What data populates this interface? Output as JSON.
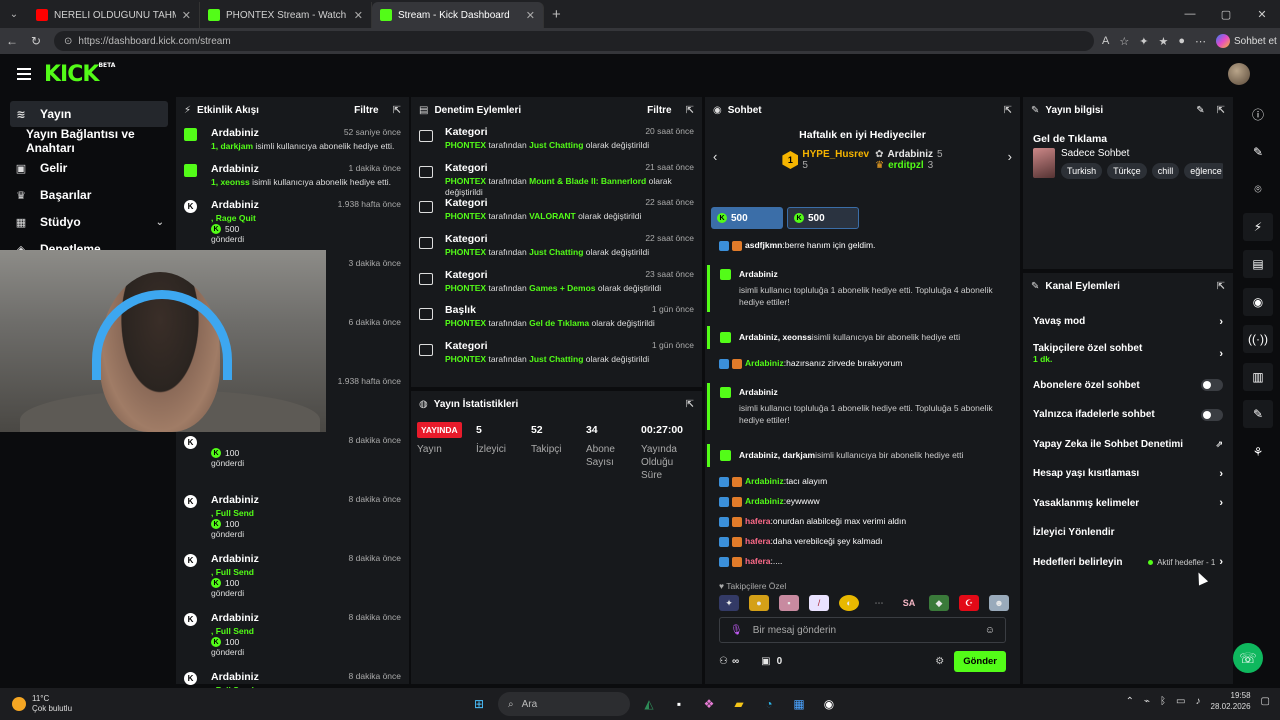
{
  "browser": {
    "tabs": [
      {
        "title": "NERELİ OLDUĞUNU TAHMİN ETİ",
        "favicon_color": "#ff0000"
      },
      {
        "title": "PHONTEX Stream - Watch Live on",
        "favicon_color": "#53fc18"
      },
      {
        "title": "Stream - Kick Dashboard",
        "favicon_color": "#53fc18",
        "active": true
      }
    ],
    "url": "https://dashboard.kick.com/stream",
    "copilot_label": "Sohbet et",
    "accent": "#53fc18"
  },
  "header": {
    "logo": "KICK",
    "logo_badge": "BETA"
  },
  "leftnav": {
    "items": [
      {
        "label": "Yayın",
        "icon": "broadcast-icon",
        "active": true
      },
      {
        "label": "Yayın Bağlantısı ve Anahtarı",
        "icon": "",
        "sub": true
      },
      {
        "label": "Gelir",
        "icon": "money-icon"
      },
      {
        "label": "Başarılar",
        "icon": "trophy-icon"
      },
      {
        "label": "Stüdyo",
        "icon": "studio-icon",
        "chevron": true
      },
      {
        "label": "Denetleme",
        "icon": "shield-icon"
      }
    ]
  },
  "activity": {
    "title": "Etkinlik Akışı",
    "filter": "Filtre",
    "items": [
      {
        "type": "gift",
        "name": "Ardabiniz",
        "time": "52 saniye önce",
        "hl": "1, darkjam",
        "desc": " isimli kullanıcıya abonelik hediye etti."
      },
      {
        "type": "gift",
        "name": "Ardabiniz",
        "time": "1 dakika önce",
        "hl": "1, xeonss",
        "desc": " isimli kullanıcıya abonelik hediye etti."
      },
      {
        "type": "kick",
        "name": "Ardabiniz",
        "time": "1.938 hafta önce",
        "hl": ", Rage Quit",
        "amount": "500",
        "sent": "gönderdi"
      },
      {
        "type": "hidden",
        "name": "",
        "time": "3 dakika önce",
        "hl": "",
        "desc": "abonelik hediye"
      },
      {
        "type": "hidden",
        "name": "",
        "time": "6 dakika önce",
        "hl": "",
        "desc": "elik hediye etti."
      },
      {
        "type": "hidden",
        "name": "",
        "time": "1.938 hafta önce",
        "hl": "",
        "desc": ""
      },
      {
        "type": "kick",
        "name": "",
        "time": "8 dakika önce",
        "hl": "",
        "amount": "100",
        "sent": "gönderdi"
      },
      {
        "type": "kick",
        "name": "Ardabiniz",
        "time": "8 dakika önce",
        "hl": ", Full Send",
        "amount": "100",
        "sent": "gönderdi"
      },
      {
        "type": "kick",
        "name": "Ardabiniz",
        "time": "8 dakika önce",
        "hl": ", Full Send",
        "amount": "100",
        "sent": "gönderdi"
      },
      {
        "type": "kick",
        "name": "Ardabiniz",
        "time": "8 dakika önce",
        "hl": ", Full Send",
        "amount": "100",
        "sent": "gönderdi"
      },
      {
        "type": "kick",
        "name": "Ardabiniz",
        "time": "8 dakika önce",
        "hl": ", Full Send",
        "amount": "100",
        "sent": ""
      }
    ]
  },
  "moderation": {
    "title": "Denetim Eylemleri",
    "filter": "Filtre",
    "items": [
      {
        "t": "Kategori",
        "time": "20 saat önce",
        "u": "PHONTEX",
        "mid": " tarafından ",
        "g": "Just Chatting",
        "end": " olarak değiştirildi"
      },
      {
        "t": "Kategori",
        "time": "21 saat önce",
        "u": "PHONTEX",
        "mid": " tarafından ",
        "g": "Mount & Blade II: Bannerlord",
        "end": " olarak değiştirildi"
      },
      {
        "t": "Kategori",
        "time": "22 saat önce",
        "u": "PHONTEX",
        "mid": " tarafından ",
        "g": "VALORANT",
        "end": " olarak değiştirildi"
      },
      {
        "t": "Kategori",
        "time": "22 saat önce",
        "u": "PHONTEX",
        "mid": " tarafından ",
        "g": "Just Chatting",
        "end": " olarak değiştirildi"
      },
      {
        "t": "Kategori",
        "time": "23 saat önce",
        "u": "PHONTEX",
        "mid": " tarafından ",
        "g": "Games + Demos",
        "end": " olarak değiştirildi"
      },
      {
        "t": "Başlık",
        "time": "1 gün önce",
        "u": "PHONTEX",
        "mid": " tarafından ",
        "g": "Gel de Tıklama",
        "end": " olarak değiştirildi"
      },
      {
        "t": "Kategori",
        "time": "1 gün önce",
        "u": "PHONTEX",
        "mid": " tarafından ",
        "g": "Just Chatting",
        "end": " olarak değiştirildi"
      }
    ]
  },
  "stats": {
    "title": "Yayın İstatistikleri",
    "live_badge": "YAYINDA",
    "live_label": "Yayın",
    "items": [
      {
        "v": "5",
        "l": "İzleyici"
      },
      {
        "v": "52",
        "l": "Takipçi"
      },
      {
        "v": "34",
        "l": "Abone Sayısı"
      },
      {
        "v": "00:27:00",
        "l": "Yayında Olduğu Süre"
      }
    ]
  },
  "chat": {
    "title": "Sohbet",
    "gifters_title": "Haftalık en iyi Hediyeciler",
    "gifters": [
      {
        "rank": "1",
        "name": "HYPE_Husrev",
        "count": "5"
      },
      {
        "name": "Ardabiniz",
        "count": "5"
      },
      {
        "name": "erditpzl",
        "count": "3"
      }
    ],
    "pins": [
      "500",
      "500"
    ],
    "messages": [
      {
        "kind": "msg",
        "user": "asdfjkmn",
        "color": "#ffffff",
        "text": " berre hanım için geldim."
      },
      {
        "kind": "sub",
        "user": "Ardabiniz",
        "text": "isimli kullanıcı topluluğa 1 abonelik hediye etti. Topluluğa 4 abonelik hediye ettiler!"
      },
      {
        "kind": "subline",
        "user": "Ardabiniz, xeonss",
        "text": " isimli kullanıcıya bir abonelik hediye etti"
      },
      {
        "kind": "msg",
        "user": "Ardabiniz",
        "color": "#53fc18",
        "text": " hazırsanız zirvede bırakıyorum"
      },
      {
        "kind": "sub",
        "user": "Ardabiniz",
        "text": "isimli kullanıcı topluluğa 1 abonelik hediye etti. Topluluğa 5 abonelik hediye ettiler!"
      },
      {
        "kind": "subline",
        "user": "Ardabiniz, darkjam",
        "text": " isimli kullanıcıya bir abonelik hediye etti"
      },
      {
        "kind": "msg",
        "user": "Ardabiniz",
        "color": "#53fc18",
        "text": " tacı alayım"
      },
      {
        "kind": "msg",
        "user": "Ardabiniz",
        "color": "#53fc18",
        "text": " eywwww"
      },
      {
        "kind": "msg",
        "user": "hafera",
        "color": "#ff6b8a",
        "text": " onurdan alabilceği max verimi aldın"
      },
      {
        "kind": "msg",
        "user": "hafera",
        "color": "#ff6b8a",
        "text": " daha verebilceği şey kalmadı"
      },
      {
        "kind": "msg",
        "user": "hafera",
        "color": "#ff6b8a",
        "text": " ...."
      }
    ],
    "followers_only": "Takipçilere Özel",
    "input_placeholder": "Bir mesaj gönderin",
    "infinity": "∞",
    "gift_count": "0",
    "send": "Gönder"
  },
  "info": {
    "title": "Yayın bilgisi",
    "stream_title": "Gel de Tıklama",
    "category": "Sadece Sohbet",
    "tags": [
      "Turkish",
      "Türkçe",
      "chill",
      "eğlence"
    ]
  },
  "channel_actions": {
    "title": "Kanal Eylemleri",
    "items": [
      {
        "label": "Yavaş mod",
        "ctl": "arrow"
      },
      {
        "label": "Takipçilere özel sohbet",
        "sub": "1 dk.",
        "ctl": "arrow"
      },
      {
        "label": "Abonelere özel sohbet",
        "ctl": "toggle"
      },
      {
        "label": "Yalnızca ifadelerle sohbet",
        "ctl": "toggle"
      },
      {
        "label": "Yapay Zeka ile Sohbet Denetimi",
        "ctl": "ext"
      },
      {
        "label": "Hesap yaşı kısıtlaması",
        "ctl": "arrow"
      },
      {
        "label": "Yasaklanmış kelimeler",
        "ctl": "arrow"
      },
      {
        "label": "İzleyici Yönlendir",
        "ctl": "none"
      },
      {
        "label": "Hedefleri belirleyin",
        "ctl": "goal",
        "status": "Aktif hedefler - 1"
      }
    ]
  },
  "taskbar": {
    "temp": "11°C",
    "weather": "Çok bulutlu",
    "search": "Ara",
    "time": "19:58",
    "date": "28.02.2026"
  }
}
